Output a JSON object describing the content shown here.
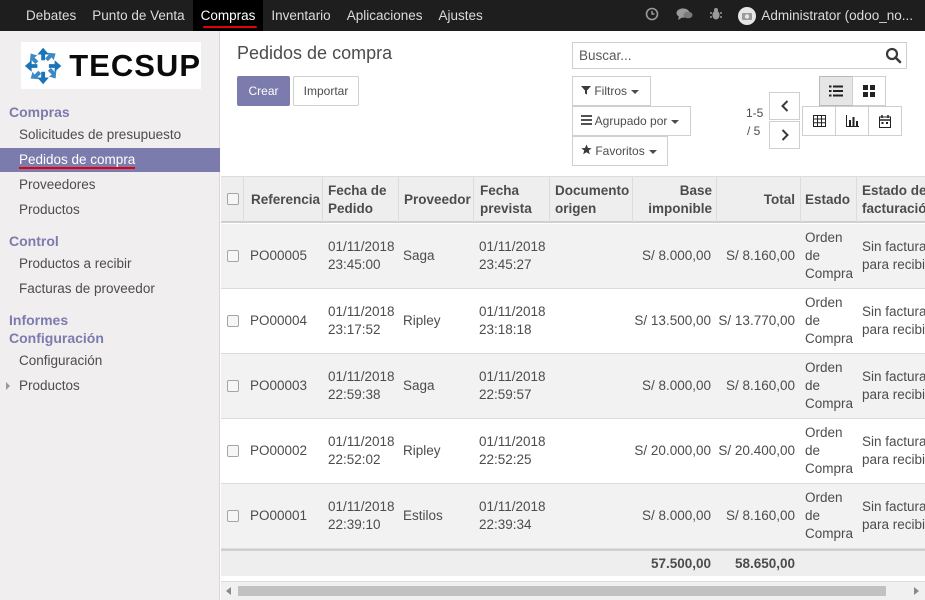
{
  "topbar": {
    "menu": [
      "Debates",
      "Punto de Venta",
      "Compras",
      "Inventario",
      "Aplicaciones",
      "Ajustes"
    ],
    "active_menu": "Compras",
    "user": "Administrator (odoo_no..."
  },
  "sidebar": {
    "logo_text": "TECSUP",
    "sections": [
      {
        "title": "Compras",
        "items": [
          "Solicitudes de presupuesto",
          "Pedidos de compra",
          "Proveedores",
          "Productos"
        ]
      },
      {
        "title": "Control",
        "items": [
          "Productos a recibir",
          "Facturas de proveedor"
        ]
      },
      {
        "title": "Informes",
        "items": []
      },
      {
        "title": "Configuración",
        "items": [
          "Configuración",
          "Productos"
        ]
      }
    ],
    "active_item": "Pedidos de compra"
  },
  "control_panel": {
    "title": "Pedidos de compra",
    "create_label": "Crear",
    "import_label": "Importar",
    "search_placeholder": "Buscar...",
    "filters_label": "Filtros",
    "groupby_label": "Agrupado por",
    "favorites_label": "Favoritos",
    "pager_range": "1-5",
    "pager_total": "/ 5"
  },
  "table": {
    "columns": [
      "Referencia",
      "Fecha de Pedido",
      "Proveedor",
      "Fecha prevista",
      "Documento origen",
      "Base imponible",
      "Total",
      "Estado",
      "Estado de facturación"
    ],
    "rows": [
      {
        "ref": "PO00005",
        "date_order": "01/11/2018 23:45:00",
        "partner": "Saga",
        "date_planned": "01/11/2018 23:45:27",
        "origin": "",
        "untaxed": "S/ 8.000,00",
        "total": "S/ 8.160,00",
        "state": "Orden de Compra",
        "invoice_status": "Sin factura para recibir"
      },
      {
        "ref": "PO00004",
        "date_order": "01/11/2018 23:17:52",
        "partner": "Ripley",
        "date_planned": "01/11/2018 23:18:18",
        "origin": "",
        "untaxed": "S/ 13.500,00",
        "total": "S/ 13.770,00",
        "state": "Orden de Compra",
        "invoice_status": "Sin factura para recibir"
      },
      {
        "ref": "PO00003",
        "date_order": "01/11/2018 22:59:38",
        "partner": "Saga",
        "date_planned": "01/11/2018 22:59:57",
        "origin": "",
        "untaxed": "S/ 8.000,00",
        "total": "S/ 8.160,00",
        "state": "Orden de Compra",
        "invoice_status": "Sin factura para recibir"
      },
      {
        "ref": "PO00002",
        "date_order": "01/11/2018 22:52:02",
        "partner": "Ripley",
        "date_planned": "01/11/2018 22:52:25",
        "origin": "",
        "untaxed": "S/ 20.000,00",
        "total": "S/ 20.400,00",
        "state": "Orden de Compra",
        "invoice_status": "Sin factura para recibir"
      },
      {
        "ref": "PO00001",
        "date_order": "01/11/2018 22:39:10",
        "partner": "Estilos",
        "date_planned": "01/11/2018 22:39:34",
        "origin": "",
        "untaxed": "S/ 8.000,00",
        "total": "S/ 8.160,00",
        "state": "Orden de Compra",
        "invoice_status": "Sin factura para recibir"
      }
    ],
    "footer": {
      "untaxed": "57.500,00",
      "total": "58.650,00"
    }
  },
  "colors": {
    "topbar": "#1e1e1e",
    "primary": "#7c7bad",
    "accent_red": "#e2000a",
    "logo_blue": "#1a74b8"
  }
}
